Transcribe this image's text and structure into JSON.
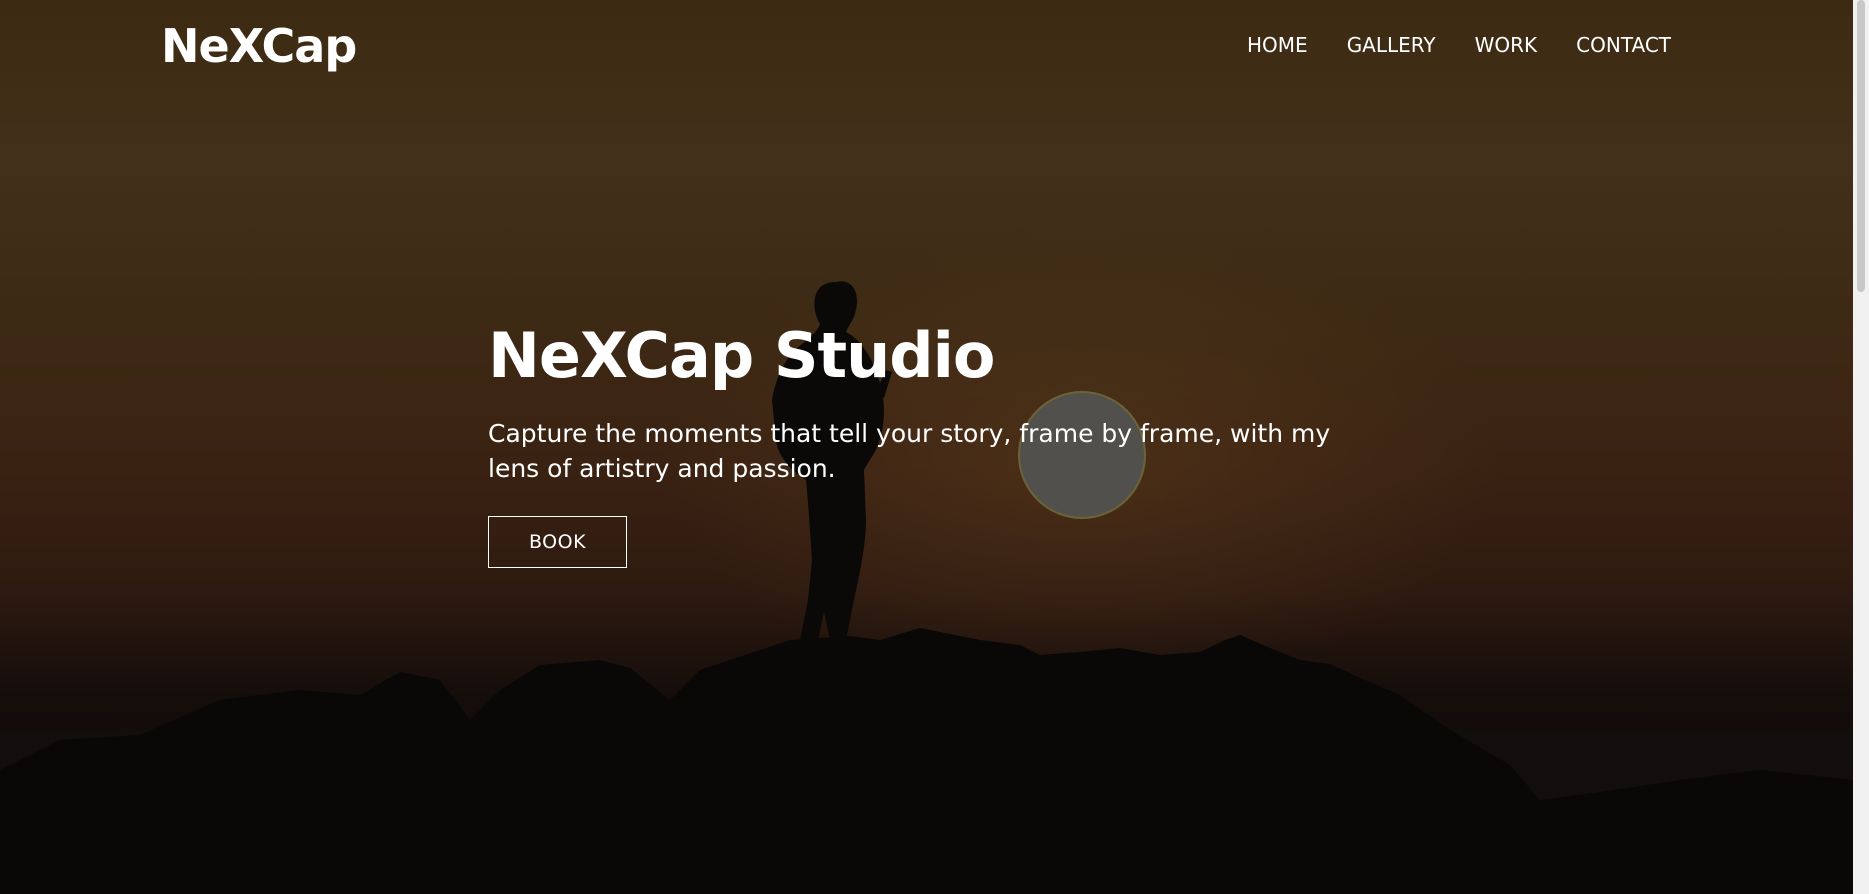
{
  "header": {
    "brand": "NeXCap",
    "nav": [
      {
        "label": "HOME"
      },
      {
        "label": "GALLERY"
      },
      {
        "label": "WORK"
      },
      {
        "label": "CONTACT"
      }
    ]
  },
  "hero": {
    "title": "NeXCap Studio",
    "tagline": "Capture the moments that tell your story, frame by frame, with my lens of artistry and passion.",
    "cta_label": "BOOK"
  },
  "colors": {
    "text": "#ffffff",
    "sky_top": "#42301a",
    "sky_horizon": "#3a2212",
    "rocks": "#0b0808"
  }
}
